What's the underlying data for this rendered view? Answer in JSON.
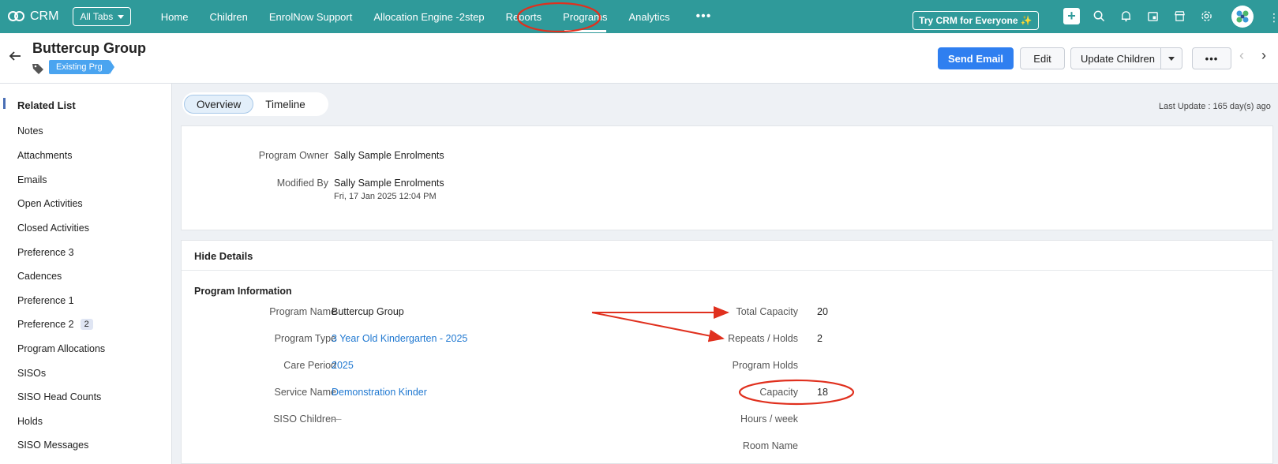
{
  "app": {
    "name": "CRM",
    "all_tabs": "All Tabs"
  },
  "nav": {
    "tabs": [
      "Home",
      "Children",
      "EnrolNow Support",
      "Allocation Engine -2step",
      "Reports",
      "Programs",
      "Analytics"
    ],
    "active": "Programs",
    "more": "•••",
    "try_crm": "Try CRM for Everyone ✨"
  },
  "icons": [
    "plus-icon",
    "search-icon",
    "bell-icon",
    "calendar-icon",
    "store-icon",
    "gear-icon",
    "avatar",
    "apps-grid-icon"
  ],
  "colors": {
    "topbar": "#2f9a9a",
    "primary": "#2f7ff0",
    "link": "#1f78d1",
    "annotation": "#e0301e"
  },
  "record": {
    "title": "Buttercup Group",
    "tag": "Existing Prg",
    "actions": {
      "send_email": "Send Email",
      "edit": "Edit",
      "update_children": "Update Children",
      "more": "•••"
    }
  },
  "sidebar": {
    "title": "Related List",
    "items": [
      {
        "label": "Notes",
        "count": ""
      },
      {
        "label": "Attachments",
        "count": ""
      },
      {
        "label": "Emails",
        "count": ""
      },
      {
        "label": "Open Activities",
        "count": ""
      },
      {
        "label": "Closed Activities",
        "count": ""
      },
      {
        "label": "Preference 3",
        "count": ""
      },
      {
        "label": "Cadences",
        "count": ""
      },
      {
        "label": "Preference 1",
        "count": ""
      },
      {
        "label": "Preference 2",
        "count": "2"
      },
      {
        "label": "Program Allocations",
        "count": ""
      },
      {
        "label": "SISOs",
        "count": ""
      },
      {
        "label": "SISO Head Counts",
        "count": ""
      },
      {
        "label": "Holds",
        "count": ""
      },
      {
        "label": "SISO Messages",
        "count": ""
      }
    ]
  },
  "view_tabs": {
    "overview": "Overview",
    "timeline": "Timeline"
  },
  "last_update": "Last Update : 165 day(s) ago",
  "summary": {
    "owner_label": "Program Owner",
    "owner": "Sally Sample Enrolments",
    "modified_label": "Modified By",
    "modified_by": "Sally Sample Enrolments",
    "modified_time": "Fri, 17 Jan 2025 12:04 PM"
  },
  "details": {
    "toggle": "Hide Details",
    "section": "Program Information",
    "left": [
      {
        "label": "Program Name",
        "value": "Buttercup Group",
        "link": false
      },
      {
        "label": "Program Type",
        "value": "3 Year Old Kindergarten - 2025",
        "link": true
      },
      {
        "label": "Care Period",
        "value": "2025",
        "link": true
      },
      {
        "label": "Service Name",
        "value": "Demonstration Kinder",
        "link": true
      },
      {
        "label": "SISO Children",
        "value": "—",
        "link": false
      }
    ],
    "right": [
      {
        "label": "Total Capacity",
        "value": "20"
      },
      {
        "label": "Repeats / Holds",
        "value": "2"
      },
      {
        "label": "Program Holds",
        "value": ""
      },
      {
        "label": "Capacity",
        "value": "18"
      },
      {
        "label": "Hours / week",
        "value": ""
      },
      {
        "label": "Room Name",
        "value": ""
      }
    ]
  }
}
